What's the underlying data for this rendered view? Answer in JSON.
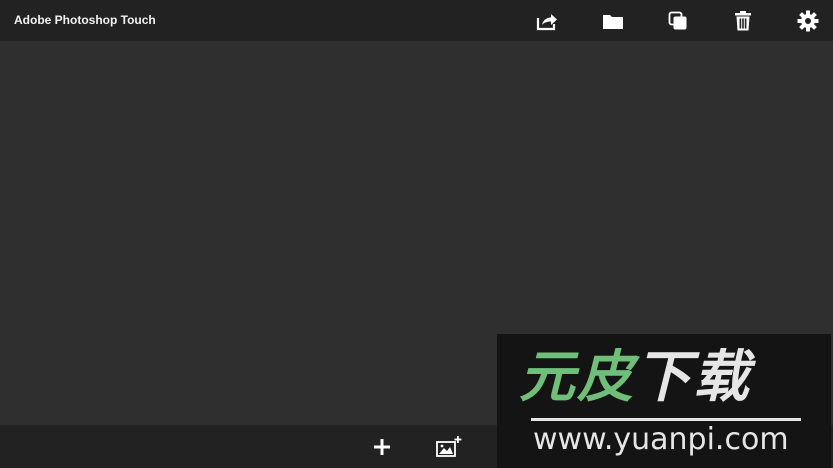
{
  "app": {
    "title": "Adobe Photoshop Touch"
  },
  "toolbar": {
    "icons": [
      "share-icon",
      "folder-icon",
      "duplicate-icon",
      "trash-icon",
      "gear-icon"
    ]
  },
  "bottom_toolbar": {
    "icons": [
      "plus-icon",
      "add-image-icon"
    ]
  },
  "watermark": {
    "chinese_part1": "元皮",
    "chinese_part2": "下载",
    "url": "www.yuanpi.com",
    "colors": {
      "green": "#6fbf7a",
      "white": "#e6e6e6"
    }
  },
  "colors": {
    "toolbar_bg": "#222222",
    "canvas_bg": "#2f2f2f",
    "icon": "#ffffff"
  }
}
